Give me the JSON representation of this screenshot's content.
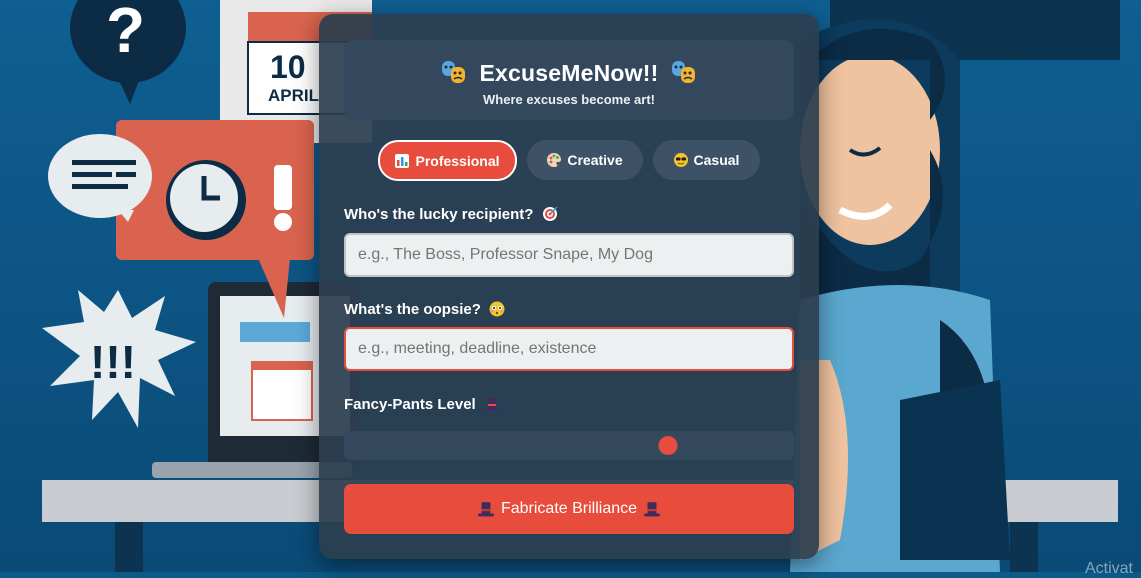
{
  "app": {
    "title": "ExcuseMeNow!!",
    "tagline": "Where excuses become art!"
  },
  "tabs": [
    {
      "label": "Professional",
      "icon": "chart-icon",
      "active": true
    },
    {
      "label": "Creative",
      "icon": "palette-icon",
      "active": false
    },
    {
      "label": "Casual",
      "icon": "sunglasses-face-icon",
      "active": false
    }
  ],
  "recipient": {
    "label": "Who's the lucky recipient?",
    "placeholder": "e.g., The Boss, Professor Snape, My Dog",
    "value": ""
  },
  "oopsie": {
    "label": "What's the oopsie?",
    "placeholder": "e.g., meeting, deadline, existence",
    "value": ""
  },
  "fancy": {
    "label": "Fancy-Pants Level",
    "level_fraction": 0.72
  },
  "cta": {
    "label": "Fabricate Brilliance"
  },
  "background": {
    "calendar_day": "10",
    "calendar_month": "APRIL",
    "question_mark": "?",
    "exclamations": "!!!",
    "exclamation_single": "!",
    "watermark": "Activat"
  },
  "colors": {
    "accent": "#e74c3c",
    "card": "#2c3e50",
    "header": "#34495e",
    "background": "#0d5a8a"
  }
}
